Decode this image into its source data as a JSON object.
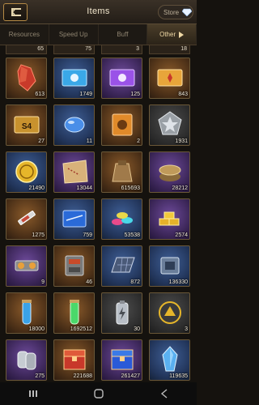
{
  "header": {
    "title": "Items",
    "store_label": "Store"
  },
  "tabs": [
    {
      "label": "Resources",
      "active": false
    },
    {
      "label": "Speed Up",
      "active": false
    },
    {
      "label": "Buff",
      "active": false
    },
    {
      "label": "Other",
      "active": true
    }
  ],
  "partial_counts": [
    "65",
    "75",
    "3",
    "18"
  ],
  "items": [
    {
      "icon": "red-crystal-icon",
      "bg": "orange",
      "count": "613"
    },
    {
      "icon": "blue-ticket-icon",
      "bg": "blue",
      "count": "1749"
    },
    {
      "icon": "purple-ticket-icon",
      "bg": "purple",
      "count": "125"
    },
    {
      "icon": "gold-ticket-icon",
      "bg": "orange",
      "count": "843"
    },
    {
      "icon": "s4-gold-card-icon",
      "bg": "orange",
      "count": "27"
    },
    {
      "icon": "blue-capsule-icon",
      "bg": "blue",
      "count": "11"
    },
    {
      "icon": "orange-card-icon",
      "bg": "orange",
      "count": "2"
    },
    {
      "icon": "silver-star-badge-icon",
      "bg": "gray",
      "count": "1931"
    },
    {
      "icon": "gold-coin-icon",
      "bg": "blue",
      "count": "21490"
    },
    {
      "icon": "treasure-map-icon",
      "bg": "purple",
      "count": "13044"
    },
    {
      "icon": "supply-sack-icon",
      "bg": "orange",
      "count": "615693"
    },
    {
      "icon": "tin-can-icon",
      "bg": "purple",
      "count": "28212"
    },
    {
      "icon": "syringe-icon",
      "bg": "orange",
      "count": "1275"
    },
    {
      "icon": "blue-blueprint-icon",
      "bg": "blue",
      "count": "759"
    },
    {
      "icon": "colored-chips-icon",
      "bg": "blue",
      "count": "53538"
    },
    {
      "icon": "gold-bars-icon",
      "bg": "purple",
      "count": "2574"
    },
    {
      "icon": "mechanical-part-icon",
      "bg": "purple",
      "count": "9"
    },
    {
      "icon": "engine-part-icon",
      "bg": "orange",
      "count": "46"
    },
    {
      "icon": "solar-panel-icon",
      "bg": "blue",
      "count": "872"
    },
    {
      "icon": "computer-chip-icon",
      "bg": "blue",
      "count": "136330"
    },
    {
      "icon": "blue-vial-icon",
      "bg": "orange",
      "count": "18000"
    },
    {
      "icon": "green-vial-icon",
      "bg": "orange",
      "count": "1692512"
    },
    {
      "icon": "battery-icon",
      "bg": "gray",
      "count": "30"
    },
    {
      "icon": "gold-emblem-icon",
      "bg": "gray",
      "count": "3"
    },
    {
      "icon": "dog-tags-icon",
      "bg": "purple",
      "count": "275"
    },
    {
      "icon": "red-chest-icon",
      "bg": "orange",
      "count": "221688"
    },
    {
      "icon": "blue-chest-icon",
      "bg": "purple",
      "count": "261427"
    },
    {
      "icon": "blue-crystal-icon",
      "bg": "blue",
      "count": "119635"
    }
  ],
  "system_bar": {
    "icons": [
      "recent-apps-icon",
      "home-icon",
      "back-icon"
    ]
  }
}
